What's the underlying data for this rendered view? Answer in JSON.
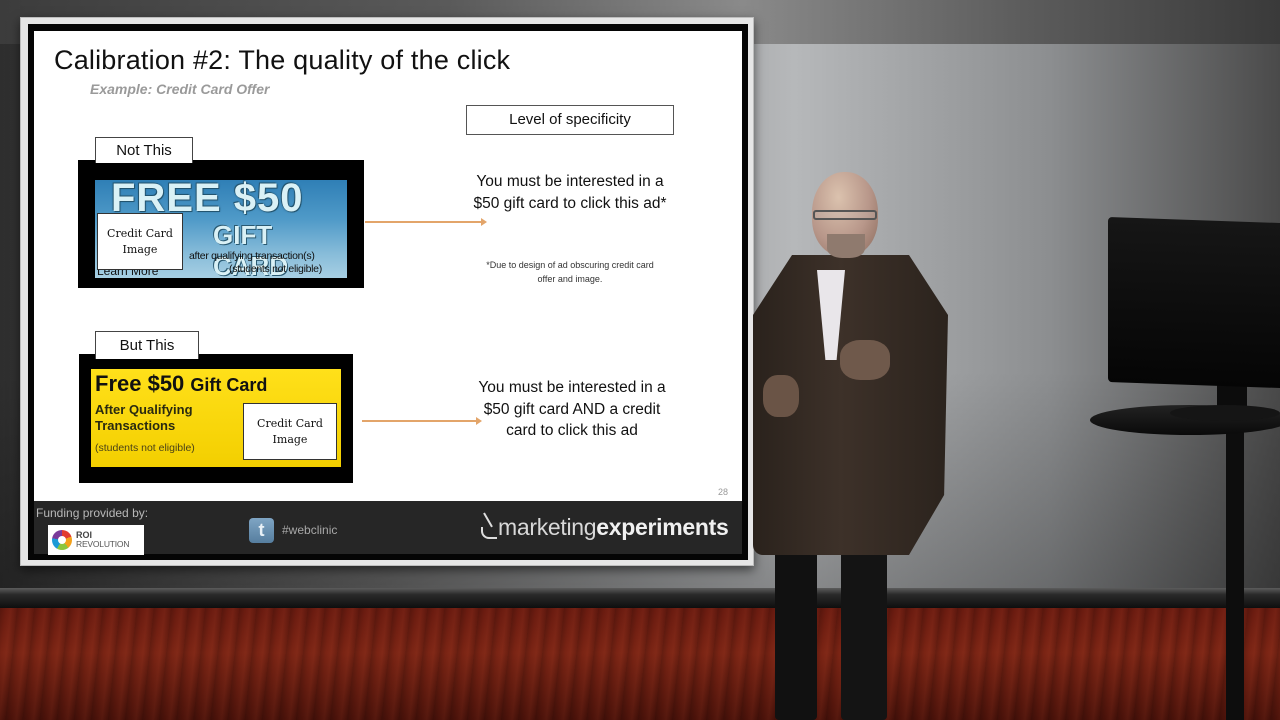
{
  "slide": {
    "title": "Calibration #2: The quality of the click",
    "subtitle": "Example: Credit Card Offer",
    "specificity_label": "Level of specificity",
    "page_number": "28",
    "ad_not": {
      "label": "Not This",
      "headline": "FREE $50",
      "subhead": "GIFT CARD",
      "line1": "after qualifying transaction(s)",
      "line2": "(students not eligible)",
      "learn_more": "Learn More",
      "placeholder": "Credit Card Image"
    },
    "ad_but": {
      "label": "But This",
      "headline_big": "Free $50",
      "headline_small": "Gift Card",
      "after": "After Qualifying Transactions",
      "students": "(students not eligible)",
      "placeholder": "Credit Card Image"
    },
    "explanation_1": "You must be interested in a $50 gift card to click this ad*",
    "footnote_1": "*Due to design of ad obscuring credit card offer and image.",
    "explanation_2": "You must be interested in a $50 gift card AND a credit card to click this ad",
    "colors": {
      "arrow": "#e3a56a",
      "ad_not_bg": "#4f9ac8",
      "ad_but_bg": "#ffe01a"
    }
  },
  "footer": {
    "funding_label": "Funding provided by:",
    "sponsor_line1": "ROI",
    "sponsor_line2": "REVOLUTION",
    "twitter_glyph": "t",
    "hashtag": "#webclinic",
    "brand_light": "marketing",
    "brand_bold": "experiments"
  },
  "icons": {
    "sponsor_logo": "roi-revolution-logo",
    "twitter": "twitter-icon",
    "brand": "marketing-experiments-logo"
  }
}
